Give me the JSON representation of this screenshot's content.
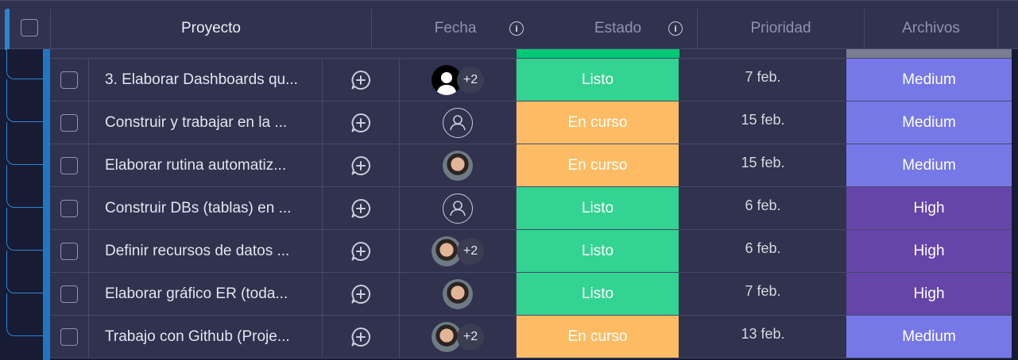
{
  "header": {
    "columns": {
      "proyecto": "Proyecto",
      "fecha": "Fecha",
      "estado": "Estado",
      "prioridad": "Prioridad",
      "archivos": "Archivos"
    }
  },
  "colors": {
    "listo": "#33d391",
    "en_curso": "#fdbc64",
    "medium": "#7678e8",
    "high": "#6645a9"
  },
  "rows": [
    {
      "name": "3. Elaborar Dashboards qu...",
      "people_extra": "+2",
      "status": "Listo",
      "date": "7 feb.",
      "priority": "Medium"
    },
    {
      "name": "Construir y trabajar en la ...",
      "people_extra": "",
      "status": "En curso",
      "date": "15 feb.",
      "priority": "Medium"
    },
    {
      "name": "Elaborar rutina automatiz...",
      "people_extra": "",
      "status": "En curso",
      "date": "15 feb.",
      "priority": "Medium"
    },
    {
      "name": "Construir DBs (tablas) en ...",
      "people_extra": "",
      "status": "Listo",
      "date": "6 feb.",
      "priority": "High"
    },
    {
      "name": "Definir recursos de datos ...",
      "people_extra": "+2",
      "status": "Listo",
      "date": "6 feb.",
      "priority": "High"
    },
    {
      "name": "Elaborar gráfico ER (toda...",
      "people_extra": "",
      "status": "Listo",
      "date": "7 feb.",
      "priority": "High"
    },
    {
      "name": "Trabajo con Github (Proje...",
      "people_extra": "+2",
      "status": "En curso",
      "date": "13 feb.",
      "priority": "Medium"
    }
  ]
}
